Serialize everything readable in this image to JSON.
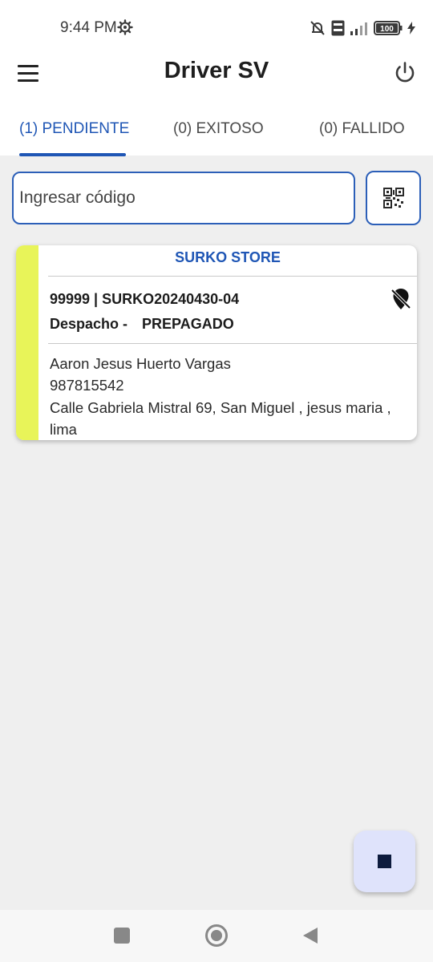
{
  "status_bar": {
    "time": "9:44 PM",
    "battery": "100",
    "icons": [
      "gear-icon",
      "silent-icon",
      "volte-icon",
      "signal-icon",
      "battery-icon",
      "charging-icon"
    ]
  },
  "app_bar": {
    "title": "Driver SV",
    "menu_icon": "menu-icon",
    "power_icon": "power-icon"
  },
  "tabs": [
    {
      "label": "(1) PENDIENTE",
      "active": true
    },
    {
      "label": "(0) EXITOSO",
      "active": false
    },
    {
      "label": "(0) FALLIDO",
      "active": false
    }
  ],
  "search": {
    "placeholder": "Ingresar código",
    "value": "",
    "scan_icon": "qr-code-icon"
  },
  "orders": [
    {
      "store": "SURKO STORE",
      "order": "99999 | SURKO20240430-04",
      "delivery_type": "Despacho -",
      "payment": "PREPAGADO",
      "customer": "Aaron Jesus Huerto Vargas",
      "phone": "987815542",
      "address_line1": "Calle Gabriela Mistral 69, San Miguel , jesus maria ,",
      "address_line2": "lima",
      "location_icon": "location-off-icon"
    }
  ],
  "fab": {
    "icon": "stop-icon"
  },
  "nav_bar": {
    "icons": [
      "recents-icon",
      "home-icon",
      "back-icon"
    ]
  },
  "colors": {
    "primary": "#1f56b5",
    "stripe": "#e8f459",
    "fab_bg": "#dfe3fb",
    "background": "#efefef"
  }
}
